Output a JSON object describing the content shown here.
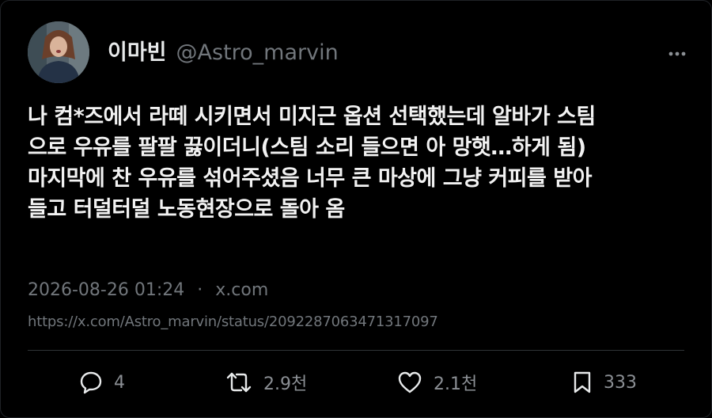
{
  "user": {
    "display_name": "이마빈",
    "handle": "@Astro_marvin"
  },
  "tweet": {
    "text": "나 컴*즈에서 라떼 시키면서 미지근 옵션 선택했는데 알바가 스팀\n으로 우유를 팔팔 끓이더니(스팀 소리 들으면 아 망햇…하게 됨)\n마지막에 찬 우유를 섞어주셨음 너무 큰 마상에 그냥 커피를 받아\n들고 터덜터덜 노동현장으로 돌아 옴",
    "timestamp": "2026-08-26 01:24",
    "separator": "·",
    "source": "x.com",
    "status_url": "https://x.com/Astro_marvin/status/2092287063471317097"
  },
  "actions": {
    "reply_count": "4",
    "retweet_count": "2.9천",
    "like_count": "2.1천",
    "bookmark_count": "333"
  },
  "icons": {
    "more": "more-horizontal-icon",
    "reply": "comment-bubble-icon",
    "retweet": "retweet-arrows-icon",
    "like": "heart-icon",
    "bookmark": "bookmark-icon"
  },
  "colors": {
    "background": "#000000",
    "text_primary": "#e7e9ea",
    "text_secondary": "#71767b",
    "divider": "#2f3336"
  }
}
